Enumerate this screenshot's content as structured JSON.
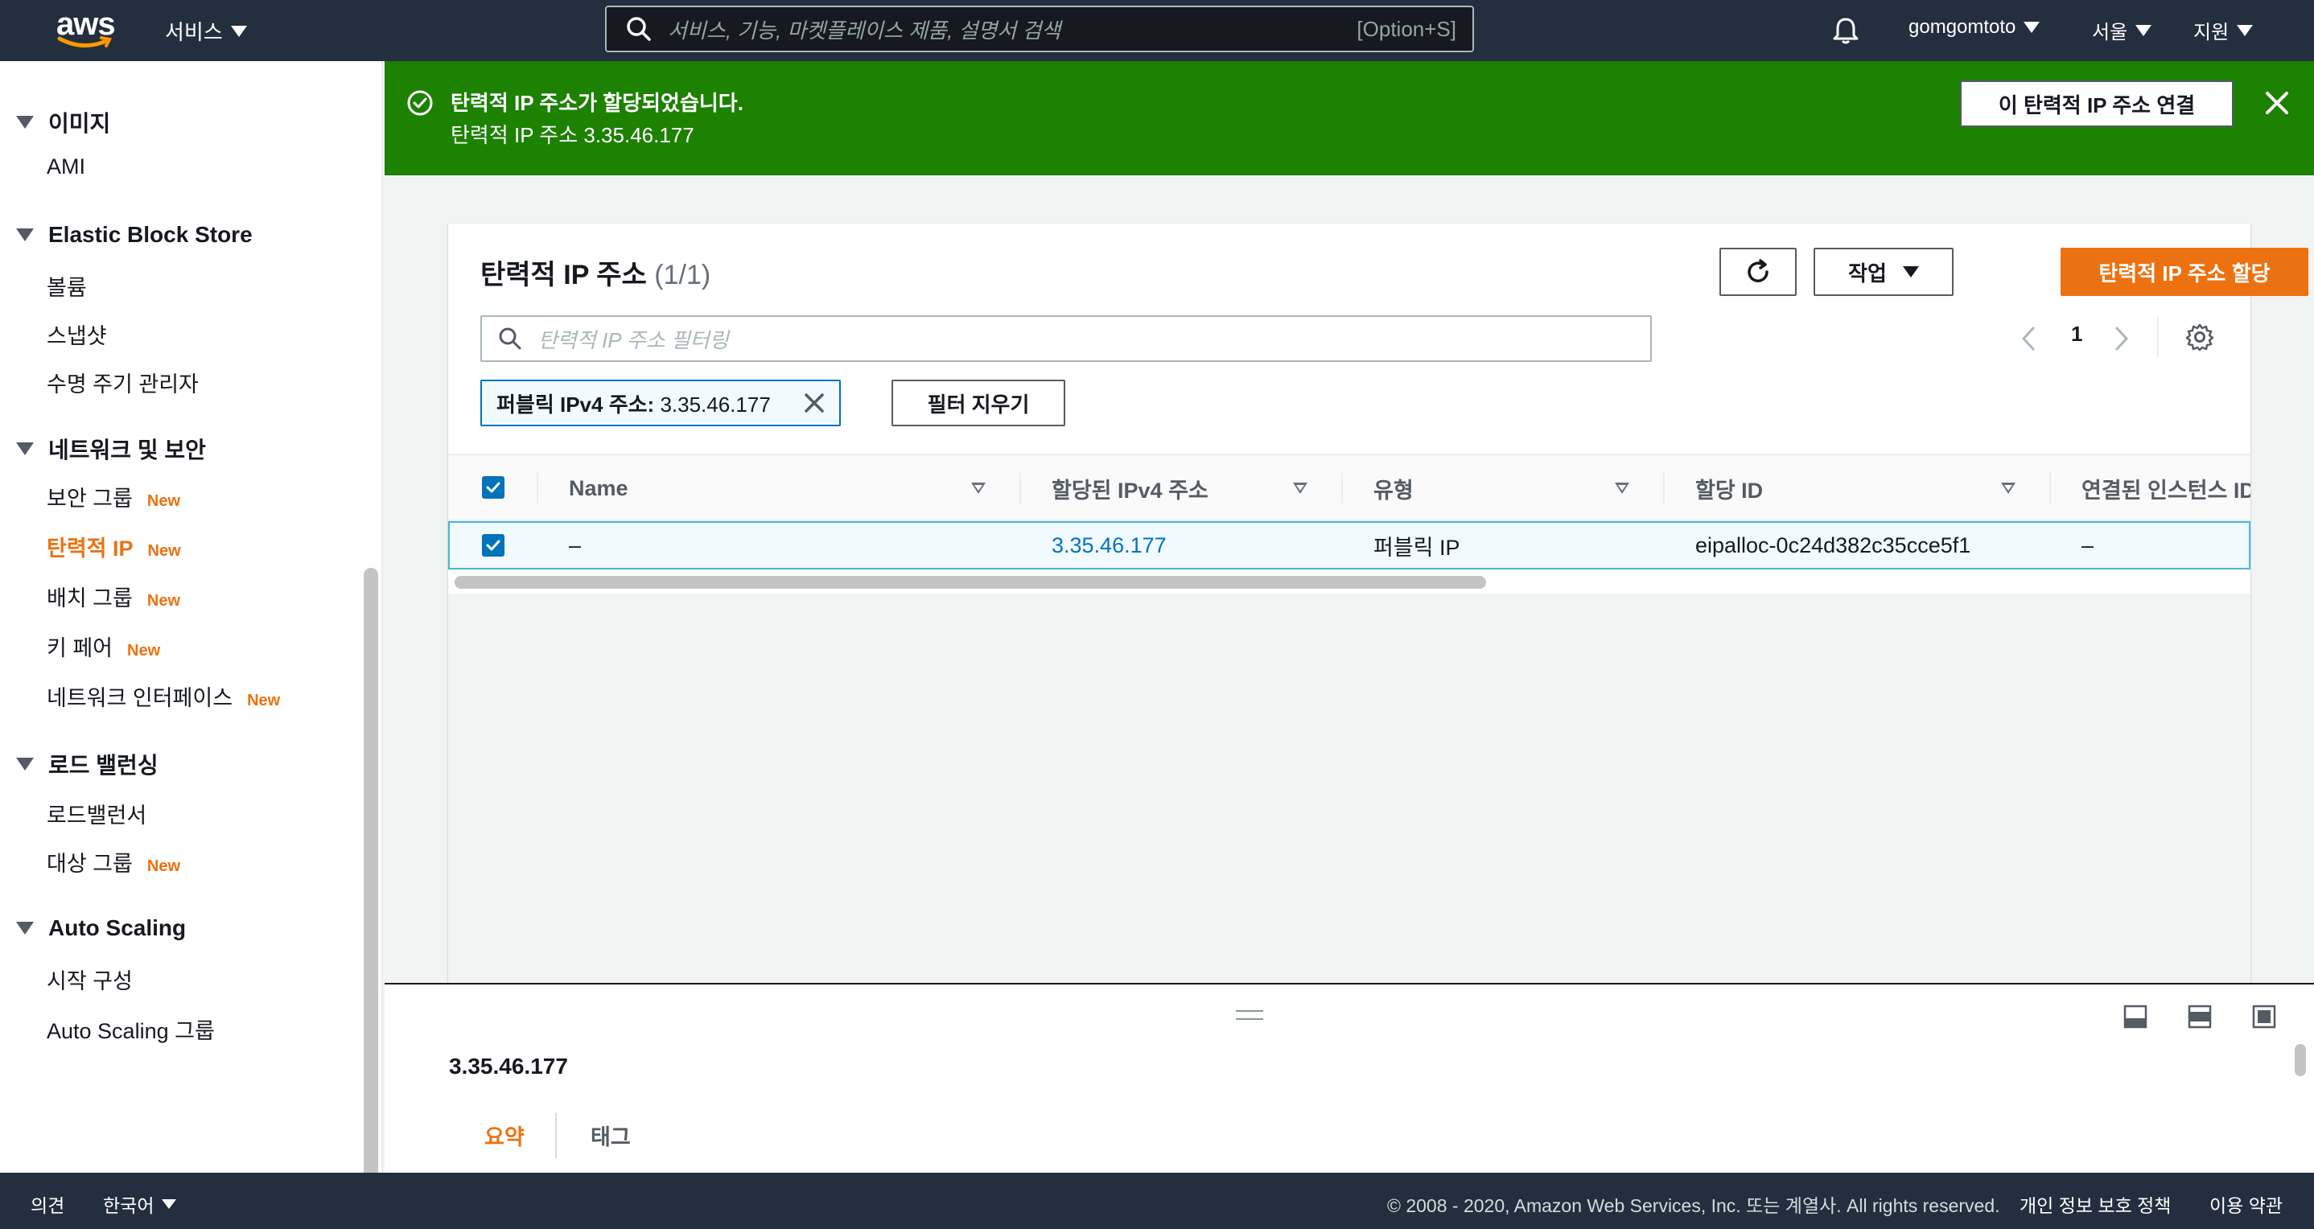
{
  "topnav": {
    "logo_text": "aws",
    "services_label": "서비스",
    "search_placeholder": "서비스, 기능, 마켓플레이스 제품, 설명서 검색",
    "search_shortcut": "[Option+S]",
    "account_label": "gomgomtoto",
    "region_label": "서울",
    "support_label": "지원"
  },
  "sidebar": {
    "sections": [
      {
        "title": "이미지",
        "items": [
          {
            "label": "AMI",
            "badge": ""
          }
        ]
      },
      {
        "title": "Elastic Block Store",
        "items": [
          {
            "label": "볼륨",
            "badge": ""
          },
          {
            "label": "스냅샷",
            "badge": ""
          },
          {
            "label": "수명 주기 관리자",
            "badge": ""
          }
        ]
      },
      {
        "title": "네트워크 및 보안",
        "items": [
          {
            "label": "보안 그룹",
            "badge": "New"
          },
          {
            "label": "탄력적 IP",
            "badge": "New"
          },
          {
            "label": "배치 그룹",
            "badge": "New"
          },
          {
            "label": "키 페어",
            "badge": "New"
          },
          {
            "label": "네트워크 인터페이스",
            "badge": "New"
          }
        ]
      },
      {
        "title": "로드 밸런싱",
        "items": [
          {
            "label": "로드밸런서",
            "badge": ""
          },
          {
            "label": "대상 그룹",
            "badge": "New"
          }
        ]
      },
      {
        "title": "Auto Scaling",
        "items": [
          {
            "label": "시작 구성",
            "badge": ""
          },
          {
            "label": "Auto Scaling 그룹",
            "badge": ""
          }
        ]
      }
    ]
  },
  "flash": {
    "title": "탄력적 IP 주소가 할당되었습니다.",
    "message": "탄력적 IP 주소 3.35.46.177",
    "action_label": "이 탄력적 IP 주소 연결"
  },
  "panel": {
    "title": "탄력적 IP 주소",
    "count": "(1/1)",
    "actions_label": "작업",
    "allocate_label": "탄력적 IP 주소 할당",
    "filter_placeholder": "탄력적 IP 주소 필터링",
    "page_number": "1",
    "token_key": "퍼블릭 IPv4 주소:",
    "token_value": "3.35.46.177",
    "clear_filters_label": "필터 지우기"
  },
  "table": {
    "columns": [
      "Name",
      "할당된 IPv4 주소",
      "유형",
      "할당 ID",
      "연결된 인스턴스 ID"
    ],
    "rows": [
      {
        "name": "–",
        "ipv4": "3.35.46.177",
        "type": "퍼블릭 IP",
        "allocation_id": "eipalloc-0c24d382c35cce5f1",
        "instance_id": "–"
      }
    ]
  },
  "split_panel": {
    "title": "3.35.46.177",
    "tabs": [
      "요약",
      "태그"
    ]
  },
  "footer": {
    "feedback_label": "의견",
    "language_label": "한국어",
    "copyright": "© 2008 - 2020, Amazon Web Services, Inc. 또는 계열사. All rights reserved.",
    "privacy_label": "개인 정보 보호 정책",
    "terms_label": "이용 약관"
  },
  "colors": {
    "nav_bg": "#232f3e",
    "success": "#1d8102",
    "accent": "#ec7211",
    "link": "#0073bb"
  }
}
